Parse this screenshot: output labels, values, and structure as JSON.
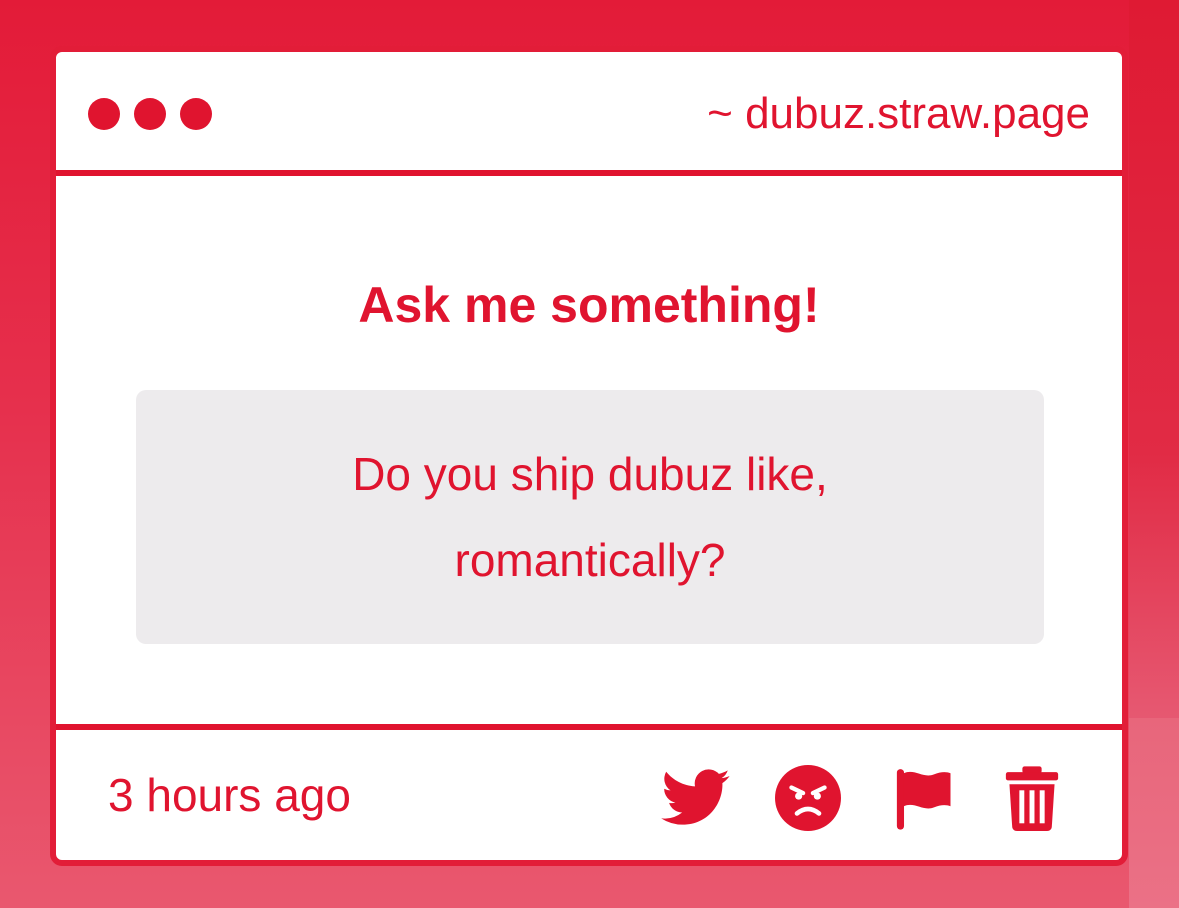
{
  "window": {
    "url_text": "~ dubuz.straw.page",
    "accent_color": "#e0142f"
  },
  "content": {
    "heading": "Ask me something!",
    "question": "Do you ship dubuz like, romantically?"
  },
  "footer": {
    "timestamp": "3 hours ago",
    "actions": [
      {
        "icon": "twitter-icon"
      },
      {
        "icon": "angry-face-icon"
      },
      {
        "icon": "flag-icon"
      },
      {
        "icon": "trash-icon"
      }
    ]
  }
}
